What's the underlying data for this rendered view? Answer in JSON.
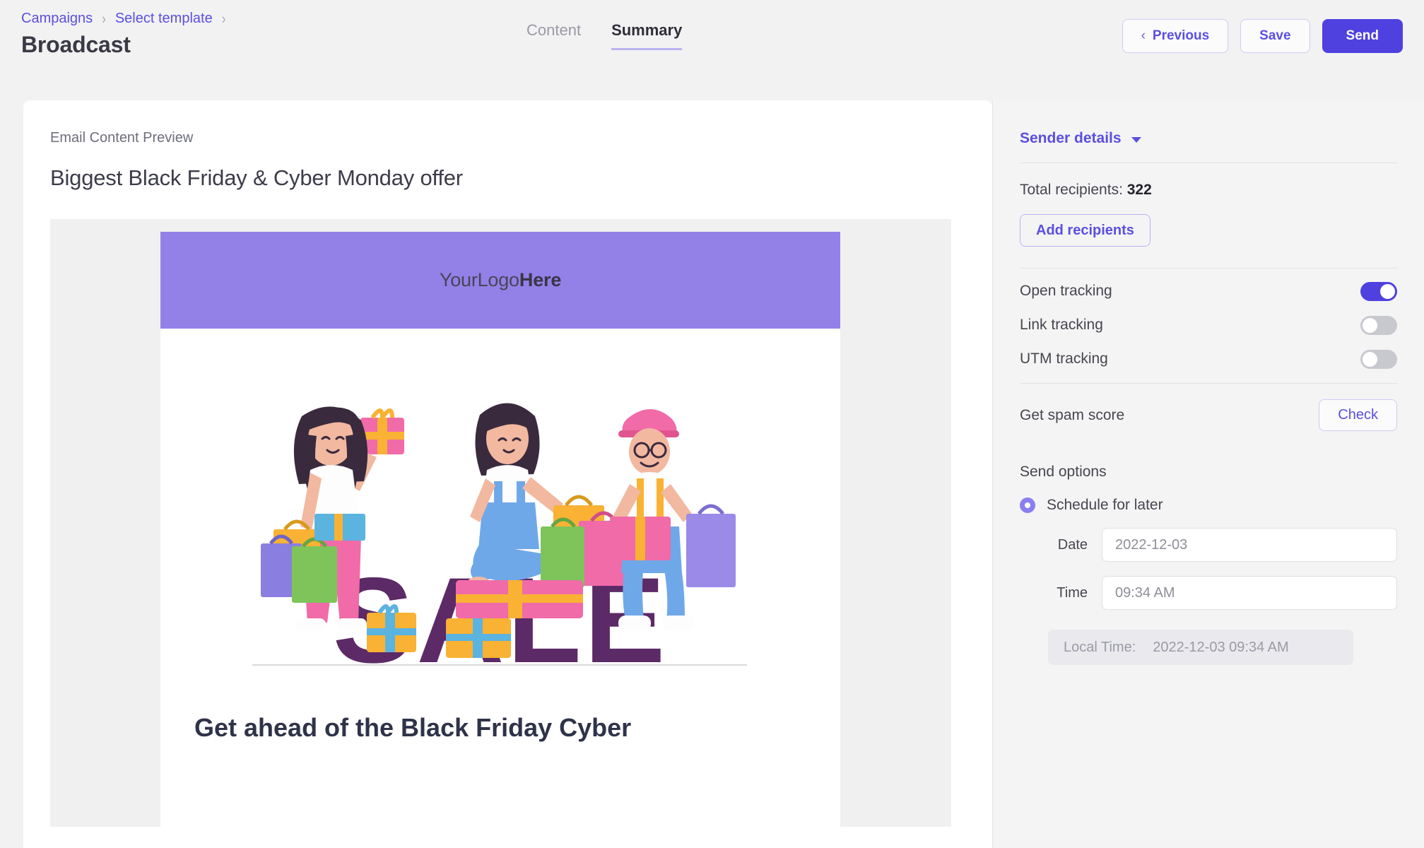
{
  "header": {
    "breadcrumb": [
      {
        "label": "Campaigns"
      },
      {
        "label": "Select template"
      }
    ],
    "separator": "›",
    "title": "Broadcast",
    "tabs": [
      {
        "label": "Content",
        "active": false
      },
      {
        "label": "Summary",
        "active": true
      }
    ],
    "actions": {
      "previous_label": "Previous",
      "previous_chevron": "‹",
      "save_label": "Save",
      "send_label": "Send"
    }
  },
  "main": {
    "preview_label": "Email Content Preview",
    "subject": "Biggest Black Friday & Cyber Monday offer",
    "email": {
      "logo_light": "YourLogo",
      "logo_bold": "Here",
      "sale_word": "SALE",
      "headline": "Get ahead of the Black Friday Cyber"
    }
  },
  "sidebar": {
    "sender_details_label": "Sender details",
    "total_recipients_label": "Total recipients:",
    "total_recipients_value": "322",
    "add_recipients_label": "Add recipients",
    "tracking": [
      {
        "label": "Open tracking",
        "on": true
      },
      {
        "label": "Link tracking",
        "on": false
      },
      {
        "label": "UTM tracking",
        "on": false
      }
    ],
    "spam_label": "Get spam score",
    "check_label": "Check",
    "send_options_label": "Send options",
    "schedule_label": "Schedule for later",
    "date_label": "Date",
    "date_value": "2022-12-03",
    "time_label": "Time",
    "time_value": "09:34 AM",
    "local_time_label": "Local Time:",
    "local_time_value": "2022-12-03 09:34 AM"
  },
  "colors": {
    "accent": "#4f41e0",
    "accent_link": "#5b4fe0",
    "banner": "#9381e8",
    "sale_purple": "#5c2a66",
    "page_bg": "#f2f2f3"
  }
}
